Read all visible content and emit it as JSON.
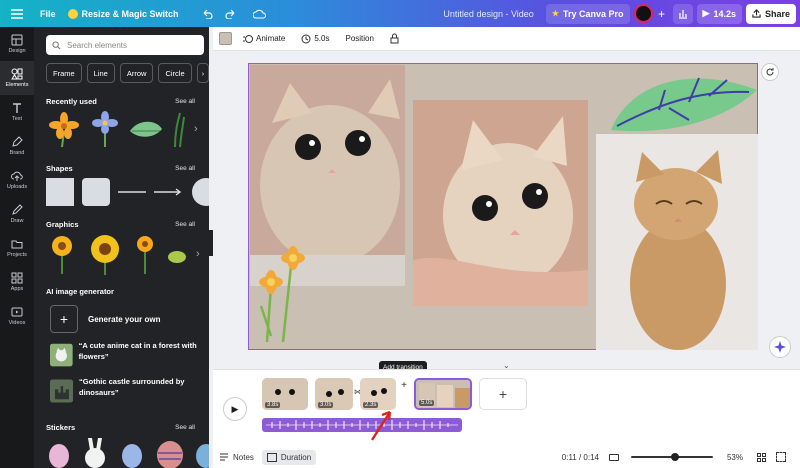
{
  "topbar": {
    "file_label": "File",
    "resize_label": "Resize & Magic Switch",
    "doc_title": "Untitled design - Video",
    "try_pro_label": "Try Canva Pro",
    "timer_label": "14.2s",
    "share_label": "Share"
  },
  "rail": [
    {
      "label": "Design",
      "icon": "layout-icon"
    },
    {
      "label": "Elements",
      "icon": "shapes-icon"
    },
    {
      "label": "Text",
      "icon": "text-icon"
    },
    {
      "label": "Brand",
      "icon": "brand-icon"
    },
    {
      "label": "Uploads",
      "icon": "upload-icon"
    },
    {
      "label": "Draw",
      "icon": "pen-icon"
    },
    {
      "label": "Projects",
      "icon": "folder-icon"
    },
    {
      "label": "Apps",
      "icon": "apps-icon"
    },
    {
      "label": "Videos",
      "icon": "video-icon"
    }
  ],
  "panel": {
    "search_placeholder": "Search elements",
    "chips": [
      "Frame",
      "Line",
      "Arrow",
      "Circle"
    ],
    "recently_used": "Recently used",
    "shapes": "Shapes",
    "graphics": "Graphics",
    "ai_generator": "AI image generator",
    "generate_own": "Generate your own",
    "prompt1": "“A cute anime cat in a forest with flowers”",
    "prompt2": "“Gothic castle surrounded by dinosaurs”",
    "stickers": "Stickers",
    "see_all": "See all"
  },
  "editbar": {
    "animate": "Animate",
    "duration": "5.0s",
    "position": "Position"
  },
  "timeline": {
    "tooltip": "Add transition",
    "clips": [
      "3.8s",
      "3.0s",
      "2.3s",
      "5.0s"
    ]
  },
  "bottom": {
    "notes": "Notes",
    "duration": "Duration",
    "time": "0:11 / 0:14",
    "zoom": "53%"
  }
}
